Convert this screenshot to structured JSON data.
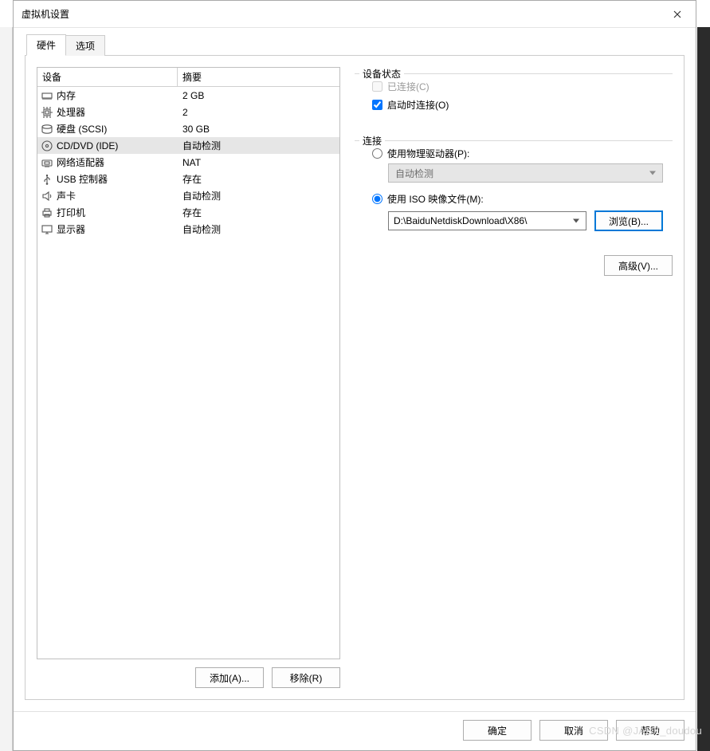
{
  "window": {
    "title": "虚拟机设置"
  },
  "tabs": {
    "hardware": "硬件",
    "options": "选项"
  },
  "table": {
    "header_device": "设备",
    "header_summary": "摘要",
    "rows": [
      {
        "icon": "memory",
        "device": "内存",
        "summary": "2 GB"
      },
      {
        "icon": "cpu",
        "device": "处理器",
        "summary": "2"
      },
      {
        "icon": "hdd",
        "device": "硬盘 (SCSI)",
        "summary": "30 GB"
      },
      {
        "icon": "cd",
        "device": "CD/DVD (IDE)",
        "summary": "自动检测"
      },
      {
        "icon": "net",
        "device": "网络适配器",
        "summary": "NAT"
      },
      {
        "icon": "usb",
        "device": "USB 控制器",
        "summary": "存在"
      },
      {
        "icon": "sound",
        "device": "声卡",
        "summary": "自动检测"
      },
      {
        "icon": "printer",
        "device": "打印机",
        "summary": "存在"
      },
      {
        "icon": "display",
        "device": "显示器",
        "summary": "自动检测"
      }
    ],
    "selected_index": 3,
    "add_label": "添加(A)...",
    "remove_label": "移除(R)"
  },
  "device_status": {
    "legend": "设备状态",
    "connected_label": "已连接(C)",
    "connect_at_poweron_label": "启动时连接(O)"
  },
  "connection": {
    "legend": "连接",
    "physical_label": "使用物理驱动器(P):",
    "physical_select": "自动检测",
    "iso_label": "使用 ISO 映像文件(M):",
    "iso_path": "D:\\BaiduNetdiskDownload\\X86\\",
    "browse_label": "浏览(B)...",
    "advanced_label": "高级(V)..."
  },
  "footer": {
    "ok": "确定",
    "cancel": "取消",
    "help": "帮助"
  },
  "watermark": "CSDN @JABX_doudou"
}
